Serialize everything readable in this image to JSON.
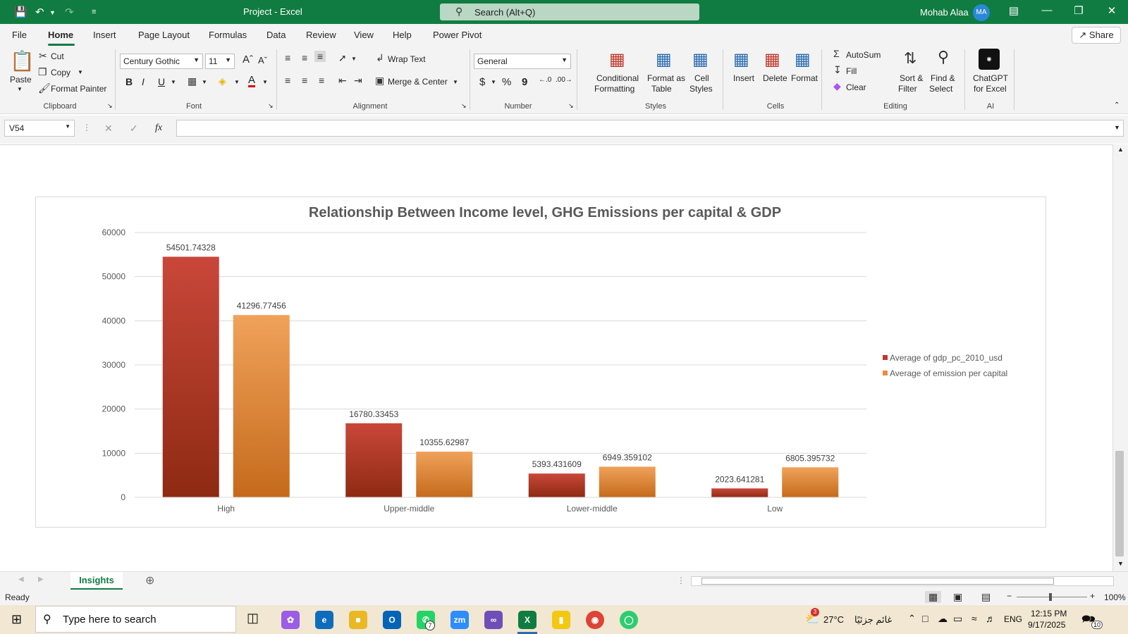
{
  "window": {
    "title": "Project  -  Excel",
    "search_placeholder": "Search (Alt+Q)",
    "user_name": "Mohab Alaa",
    "user_initials": "MA"
  },
  "menu": {
    "tabs": [
      "File",
      "Home",
      "Insert",
      "Page Layout",
      "Formulas",
      "Data",
      "Review",
      "View",
      "Help",
      "Power Pivot"
    ],
    "share_label": "Share"
  },
  "ribbon": {
    "clipboard": {
      "paste": "Paste",
      "cut": "Cut",
      "copy": "Copy",
      "format_painter": "Format Painter",
      "label": "Clipboard"
    },
    "font": {
      "family": "Century Gothic",
      "size": "11",
      "bold": "B",
      "italic": "I",
      "underline": "U",
      "label": "Font"
    },
    "alignment": {
      "wrap_text": "Wrap Text",
      "merge_center": "Merge & Center",
      "label": "Alignment"
    },
    "number": {
      "format": "General",
      "currency": "$",
      "percent": "%",
      "comma": "9",
      "label": "Number"
    },
    "styles": {
      "conditional_1": "Conditional",
      "conditional_2": "Formatting",
      "format_table_1": "Format as",
      "format_table_2": "Table",
      "cell_styles_1": "Cell",
      "cell_styles_2": "Styles",
      "label": "Styles"
    },
    "cells": {
      "insert": "Insert",
      "delete": "Delete",
      "format": "Format",
      "label": "Cells"
    },
    "editing": {
      "autosum": "AutoSum",
      "fill": "Fill",
      "clear": "Clear",
      "sort_1": "Sort &",
      "sort_2": "Filter",
      "find_1": "Find &",
      "find_2": "Select",
      "label": "Editing"
    },
    "ai": {
      "chatgpt_1": "ChatGPT",
      "chatgpt_2": "for Excel",
      "label": "AI"
    }
  },
  "formula_bar": {
    "name_box": "V54",
    "fx": "fx",
    "formula": ""
  },
  "chart_data": {
    "type": "bar",
    "title": "Relationship Between Income level, GHG Emissions per capital & GDP",
    "categories": [
      "High",
      "Upper-middle",
      "Lower-middle",
      "Low"
    ],
    "series": [
      {
        "name": "Average of gdp_pc_2010_usd",
        "values": [
          54501.74328,
          16780.33453,
          5393.431609,
          2023.641281
        ],
        "labels": [
          "54501.74328",
          "16780.33453",
          "5393.431609",
          "2023.641281"
        ],
        "color": "#c0392b"
      },
      {
        "name": "Average of emission per capital",
        "values": [
          41296.77456,
          10355.62987,
          6949.359102,
          6805.395732
        ],
        "labels": [
          "41296.77456",
          "10355.62987",
          "6949.359102",
          "6805.395732"
        ],
        "color": "#eb8c3c"
      }
    ],
    "ylim": [
      0,
      60000
    ],
    "yticks": [
      "0",
      "10000",
      "20000",
      "30000",
      "40000",
      "50000",
      "60000"
    ],
    "grid": true,
    "legend": "right"
  },
  "sheet_tabs": {
    "active": "Insights"
  },
  "status": {
    "ready": "Ready",
    "zoom": "100%"
  },
  "taskbar": {
    "search_placeholder": "Type here to search",
    "weather": "27°C",
    "weather_desc": "غائم جزئيًا",
    "language": "ENG",
    "time": "12:15 PM",
    "date": "9/17/2025",
    "whatsapp_badge": "7",
    "weather_badge": "3",
    "notifications": "10"
  }
}
